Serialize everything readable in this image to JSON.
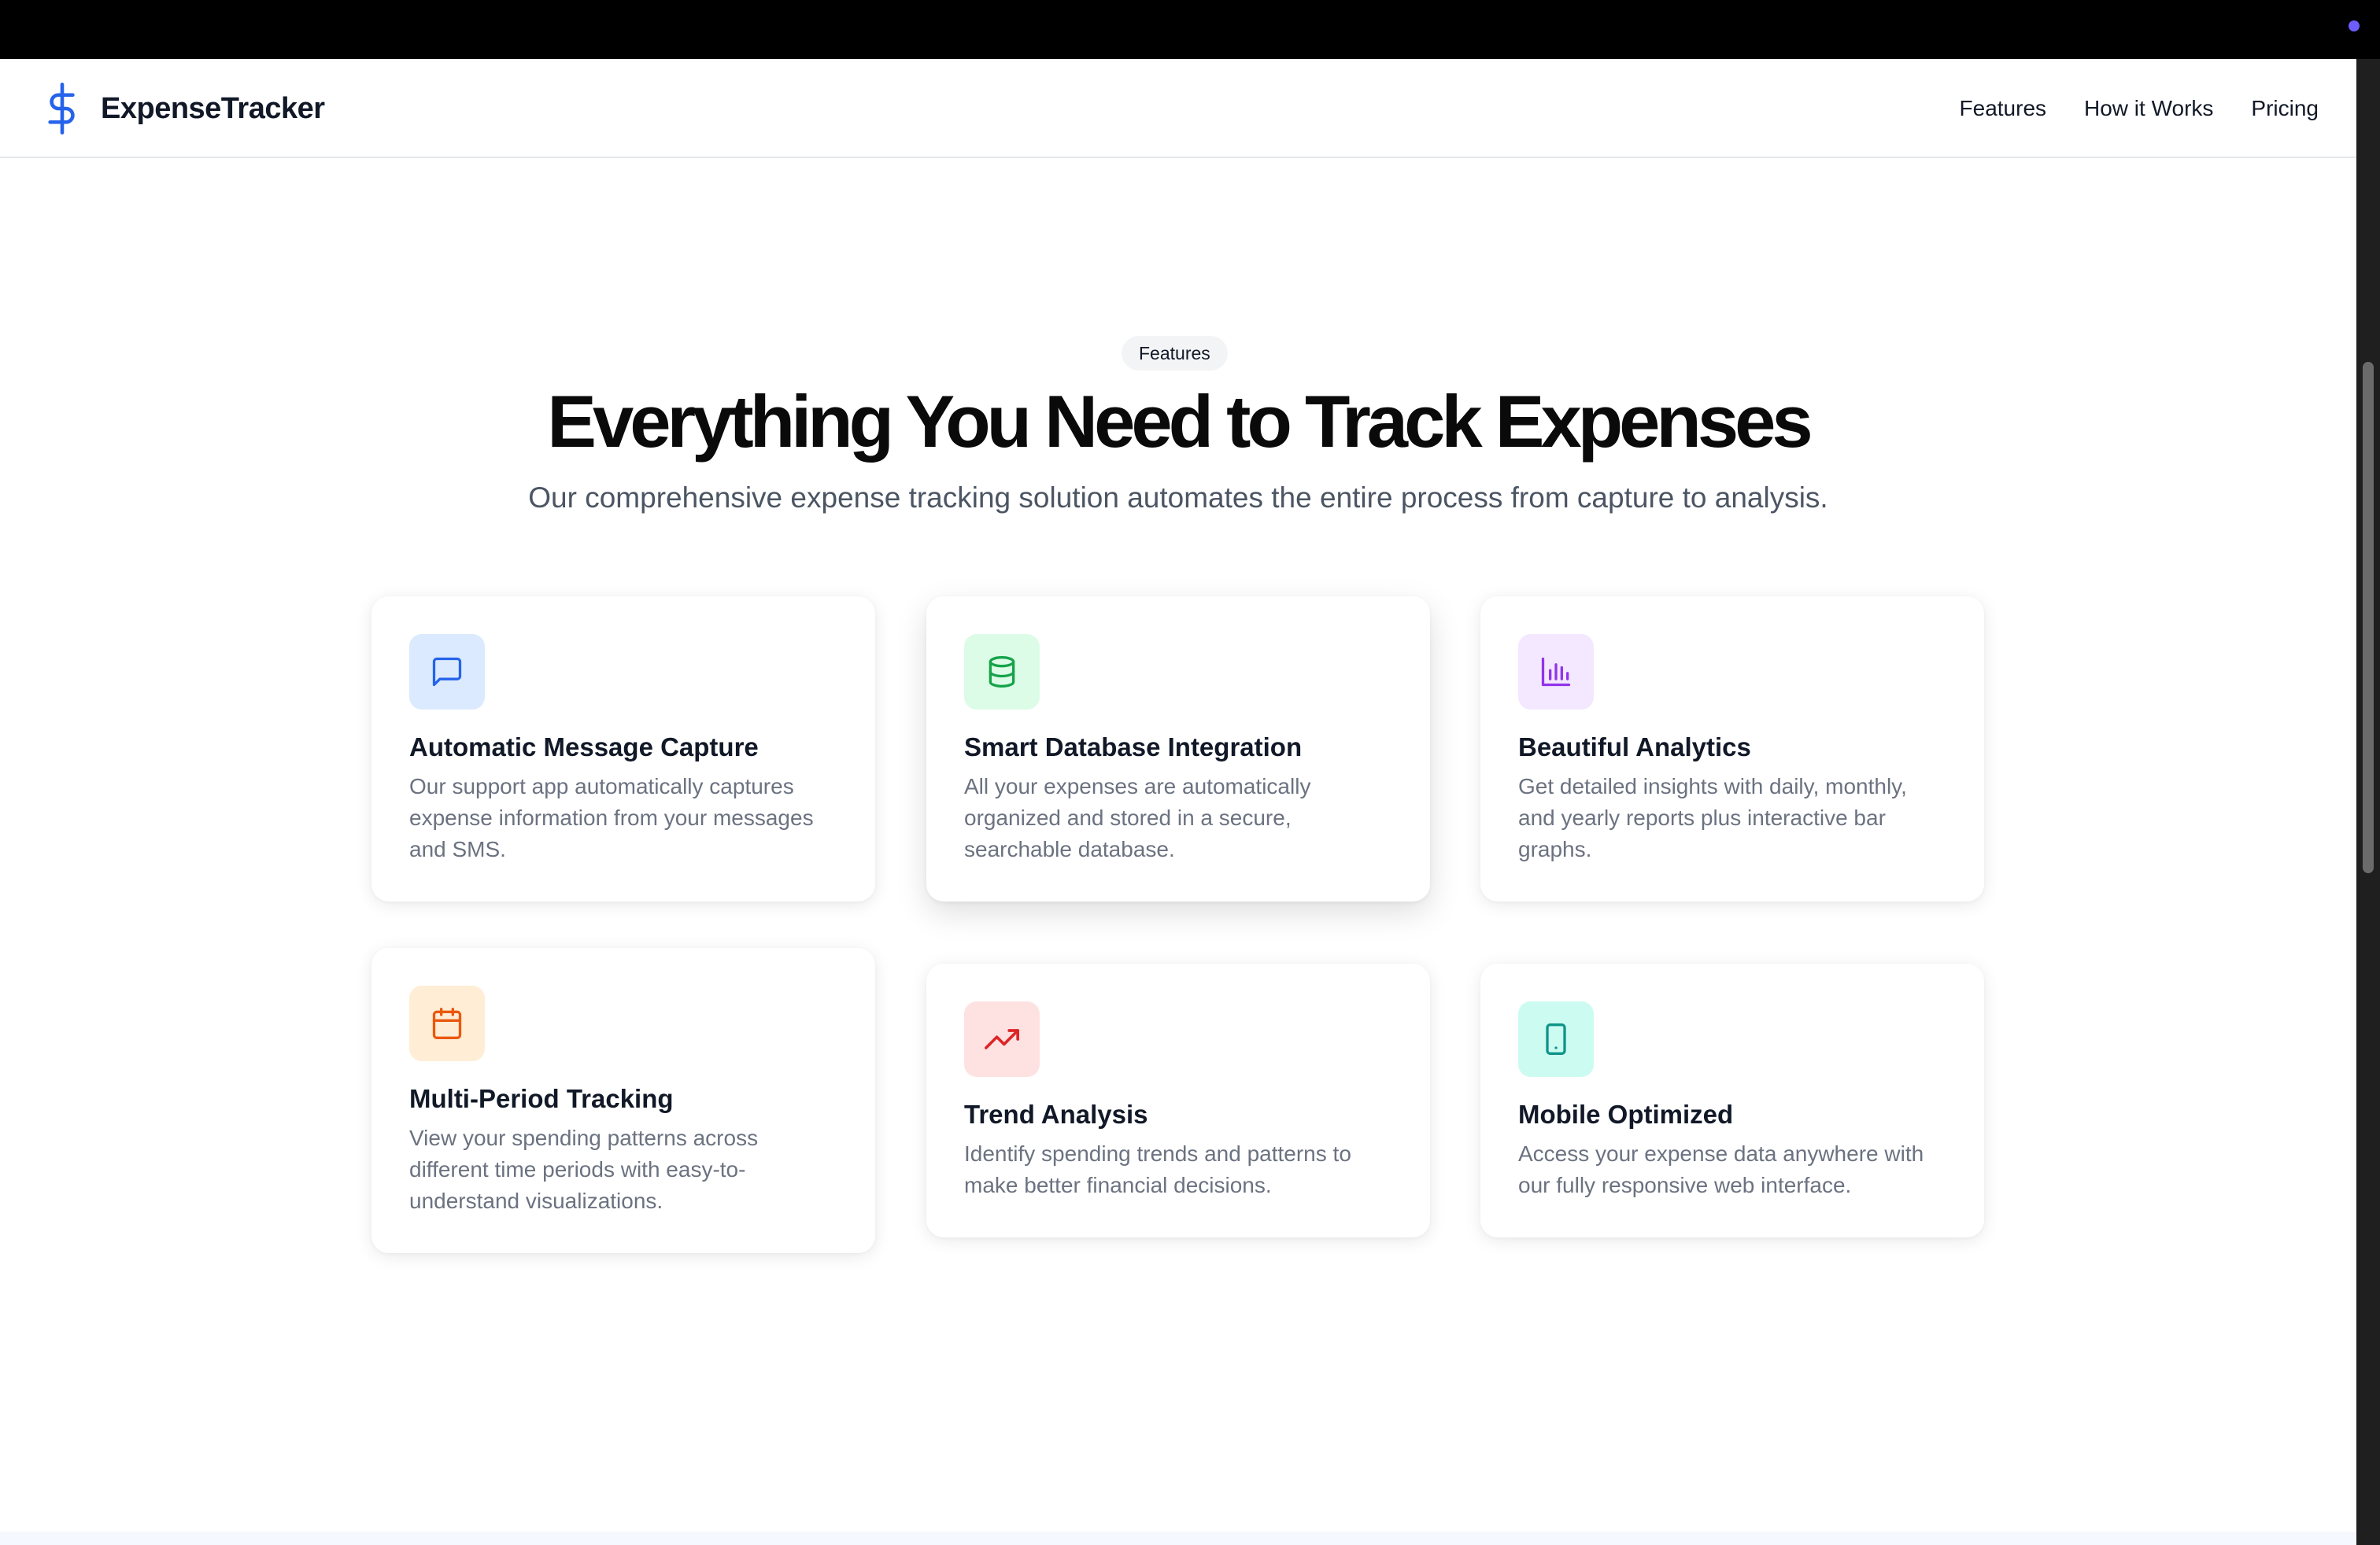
{
  "brand": {
    "name": "ExpenseTracker",
    "accent": "#2563eb"
  },
  "nav": {
    "items": [
      "Features",
      "How it Works",
      "Pricing"
    ]
  },
  "hero": {
    "pill": "Features",
    "title": "Everything You Need to Track Expenses",
    "subtitle": "Our comprehensive expense tracking solution automates the entire process from capture to analysis."
  },
  "features": [
    {
      "icon": "message-square-icon",
      "icon_bg": "#dbeafe",
      "icon_color": "#2563eb",
      "title": "Automatic Message Capture",
      "desc": "Our support app automatically captures expense information from your messages and SMS."
    },
    {
      "icon": "database-icon",
      "icon_bg": "#dcfce7",
      "icon_color": "#16a34a",
      "title": "Smart Database Integration",
      "desc": "All your expenses are automatically organized and stored in a secure, searchable database."
    },
    {
      "icon": "bar-chart-icon",
      "icon_bg": "#f3e8ff",
      "icon_color": "#9333ea",
      "title": "Beautiful Analytics",
      "desc": "Get detailed insights with daily, monthly, and yearly reports plus interactive bar graphs."
    },
    {
      "icon": "calendar-icon",
      "icon_bg": "#ffedd5",
      "icon_color": "#ea580c",
      "title": "Multi-Period Tracking",
      "desc": "View your spending patterns across different time periods with easy-to-understand visualizations."
    },
    {
      "icon": "trending-up-icon",
      "icon_bg": "#fee2e2",
      "icon_color": "#dc2626",
      "title": "Trend Analysis",
      "desc": "Identify spending trends and patterns to make better financial decisions."
    },
    {
      "icon": "smartphone-icon",
      "icon_bg": "#ccfbf1",
      "icon_color": "#0d9488",
      "title": "Mobile Optimized",
      "desc": "Access your expense data anywhere with our fully responsive web interface."
    }
  ]
}
